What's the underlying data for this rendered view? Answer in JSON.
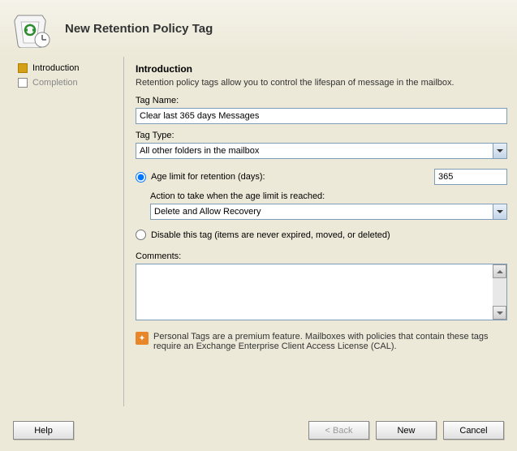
{
  "header": {
    "title": "New Retention Policy Tag"
  },
  "sidebar": {
    "steps": [
      {
        "label": "Introduction",
        "active": true
      },
      {
        "label": "Completion",
        "active": false
      }
    ]
  },
  "content": {
    "title": "Introduction",
    "desc": "Retention policy tags allow you to control the lifespan of message in the mailbox.",
    "tagNameLabel": "Tag Name:",
    "tagNameValue": "Clear last 365 days Messages",
    "tagTypeLabel": "Tag Type:",
    "tagTypeValue": "All other folders in the mailbox",
    "ageLimitLabel": "Age limit for retention (days):",
    "ageLimitValue": "365",
    "actionLabel": "Action to take when the age limit is reached:",
    "actionValue": "Delete and Allow Recovery",
    "disableLabel": "Disable this tag (items are never expired, moved, or deleted)",
    "commentsLabel": "Comments:",
    "commentsValue": "",
    "infoText": "Personal Tags are a premium feature. Mailboxes with policies that contain these tags require an Exchange Enterprise Client Access License (CAL)."
  },
  "footer": {
    "help": "Help",
    "back": "< Back",
    "next": "New",
    "cancel": "Cancel"
  }
}
